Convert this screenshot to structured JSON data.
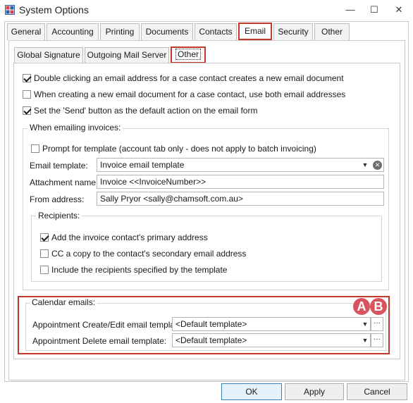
{
  "window": {
    "title": "System Options",
    "app_icon": "app-grid-icon"
  },
  "title_buttons": {
    "minimize": "—",
    "maximize": "☐",
    "close": "✕"
  },
  "tabs": [
    {
      "label": "General"
    },
    {
      "label": "Accounting"
    },
    {
      "label": "Printing"
    },
    {
      "label": "Documents"
    },
    {
      "label": "Contacts"
    },
    {
      "label": "Email"
    },
    {
      "label": "Security"
    },
    {
      "label": "Other"
    }
  ],
  "active_tab": "Email",
  "subtabs": [
    {
      "label": "Global Signature"
    },
    {
      "label": "Outgoing Mail Server"
    },
    {
      "label": "Other"
    }
  ],
  "active_subtab": "Other",
  "options": {
    "double_click": {
      "label": "Double clicking an email address for a case contact creates a new email document",
      "checked": true
    },
    "both_addresses": {
      "label": "When creating a new email document for a case contact, use both email addresses",
      "checked": false
    },
    "send_default": {
      "label": "Set the 'Send' button as the default action on the email form",
      "checked": true
    }
  },
  "invoices": {
    "title": "When emailing invoices:",
    "prompt": {
      "label": "Prompt for template (account tab only - does not apply to batch invoicing)",
      "checked": false
    },
    "email_template": {
      "label": "Email template:",
      "value": "Invoice email template"
    },
    "attachment_name": {
      "label": "Attachment name:",
      "value": "Invoice <<InvoiceNumber>>"
    },
    "from_address": {
      "label": "From address:",
      "value": "Sally Pryor <sally@chamsoft.com.au>"
    },
    "recipients": {
      "title": "Recipients:",
      "primary": {
        "label": "Add the invoice contact's primary address",
        "checked": true
      },
      "secondary": {
        "label": "CC a copy to the contact's secondary email address",
        "checked": false
      },
      "template": {
        "label": "Include the recipients specified by the template",
        "checked": false
      }
    }
  },
  "calendar": {
    "title": "Calendar emails:",
    "create_edit": {
      "label": "Appointment Create/Edit email template:",
      "value": "<Default template>"
    },
    "delete": {
      "label": "Appointment Delete email template:",
      "value": "<Default template>"
    }
  },
  "markers": {
    "a": "A",
    "b": "B"
  },
  "dropdown_glyph": "▼",
  "clear_glyph": "✕",
  "ellipsis_glyph": "···",
  "buttons": {
    "ok": "OK",
    "apply": "Apply",
    "cancel": "Cancel"
  },
  "colors": {
    "highlight": "#c0392b",
    "marker": "#d8555f"
  }
}
